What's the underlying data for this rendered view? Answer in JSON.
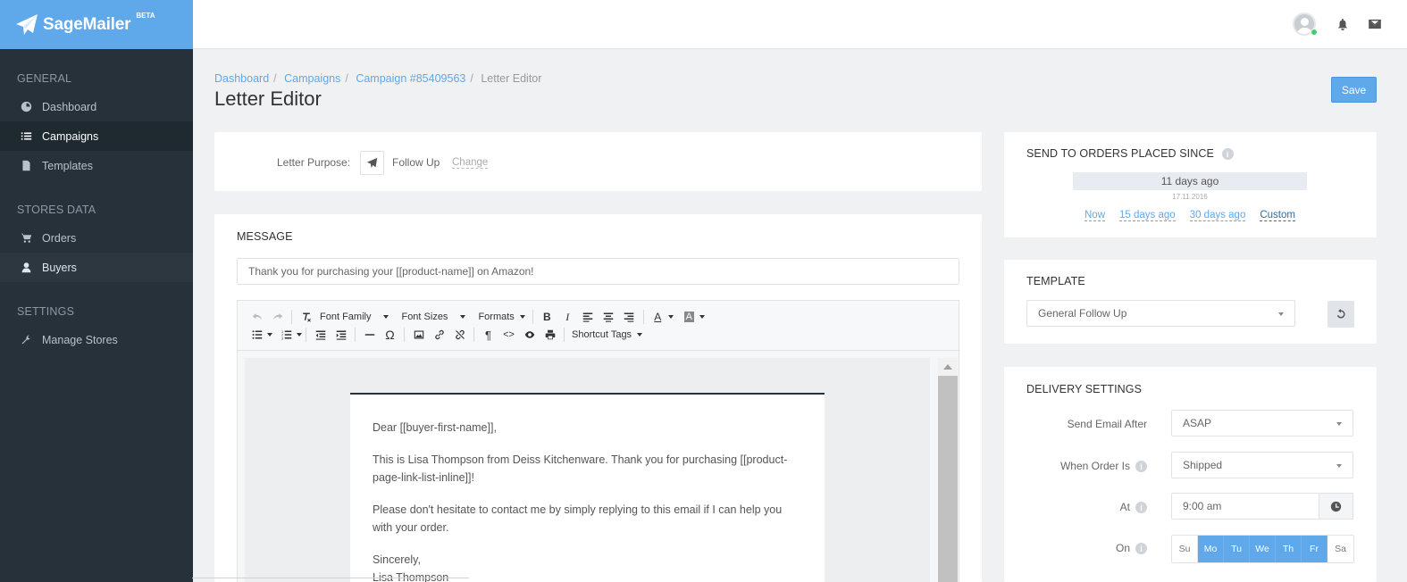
{
  "brand": {
    "name": "SageMailer",
    "badge": "BETA"
  },
  "sidebar": {
    "sections": [
      {
        "title": "GENERAL",
        "items": [
          {
            "label": "Dashboard",
            "icon": "dashboard-icon"
          },
          {
            "label": "Campaigns",
            "icon": "list-icon",
            "active": true
          },
          {
            "label": "Templates",
            "icon": "file-icon"
          }
        ]
      },
      {
        "title": "STORES DATA",
        "items": [
          {
            "label": "Orders",
            "icon": "cart-icon"
          },
          {
            "label": "Buyers",
            "icon": "user-icon"
          }
        ]
      },
      {
        "title": "SETTINGS",
        "items": [
          {
            "label": "Manage Stores",
            "icon": "wrench-icon"
          }
        ]
      }
    ]
  },
  "topbar": {
    "icons": [
      "avatar",
      "bell-icon",
      "mail-icon"
    ]
  },
  "breadcrumb": [
    "Dashboard",
    "Campaigns",
    "Campaign #85409563",
    "Letter Editor"
  ],
  "page_title": "Letter Editor",
  "save_label": "Save",
  "purpose": {
    "label": "Letter Purpose:",
    "value": "Follow Up",
    "change": "Change"
  },
  "message": {
    "title": "MESSAGE",
    "subject": "Thank you for purchasing your [[product-name]] on Amazon!",
    "toolbar": {
      "font_family": "Font Family",
      "font_sizes": "Font Sizes",
      "formats": "Formats",
      "shortcut_tags": "Shortcut Tags"
    },
    "body": [
      "Dear [[buyer-first-name]],",
      "This is Lisa Thompson from Deiss Kitchenware. Thank you for purchasing [[product-page-link-list-inline]]!",
      "Please don't hesitate to contact me by simply replying to this email if I can help you with your order.",
      "Sincerely,",
      "Lisa Thompson"
    ]
  },
  "send_since": {
    "title": "SEND TO ORDERS PLACED SINCE",
    "value": "11 days ago",
    "date": "17.11.2016",
    "links": [
      "Now",
      "15 days ago",
      "30 days ago",
      "Custom"
    ]
  },
  "template": {
    "title": "TEMPLATE",
    "selected": "General Follow Up"
  },
  "delivery": {
    "title": "DELIVERY SETTINGS",
    "send_after_label": "Send Email After",
    "send_after_value": "ASAP",
    "when_label": "When Order Is",
    "when_value": "Shipped",
    "at_label": "At",
    "at_value": "9:00 am",
    "on_label": "On",
    "days": [
      {
        "label": "Su",
        "on": false
      },
      {
        "label": "Mo",
        "on": true
      },
      {
        "label": "Tu",
        "on": true
      },
      {
        "label": "We",
        "on": true
      },
      {
        "label": "Th",
        "on": true
      },
      {
        "label": "Fr",
        "on": true
      },
      {
        "label": "Sa",
        "on": false
      }
    ]
  },
  "colors": {
    "brand": "#5fa8ea",
    "sidebar": "#26313a",
    "accent": "#5fa8ea"
  }
}
